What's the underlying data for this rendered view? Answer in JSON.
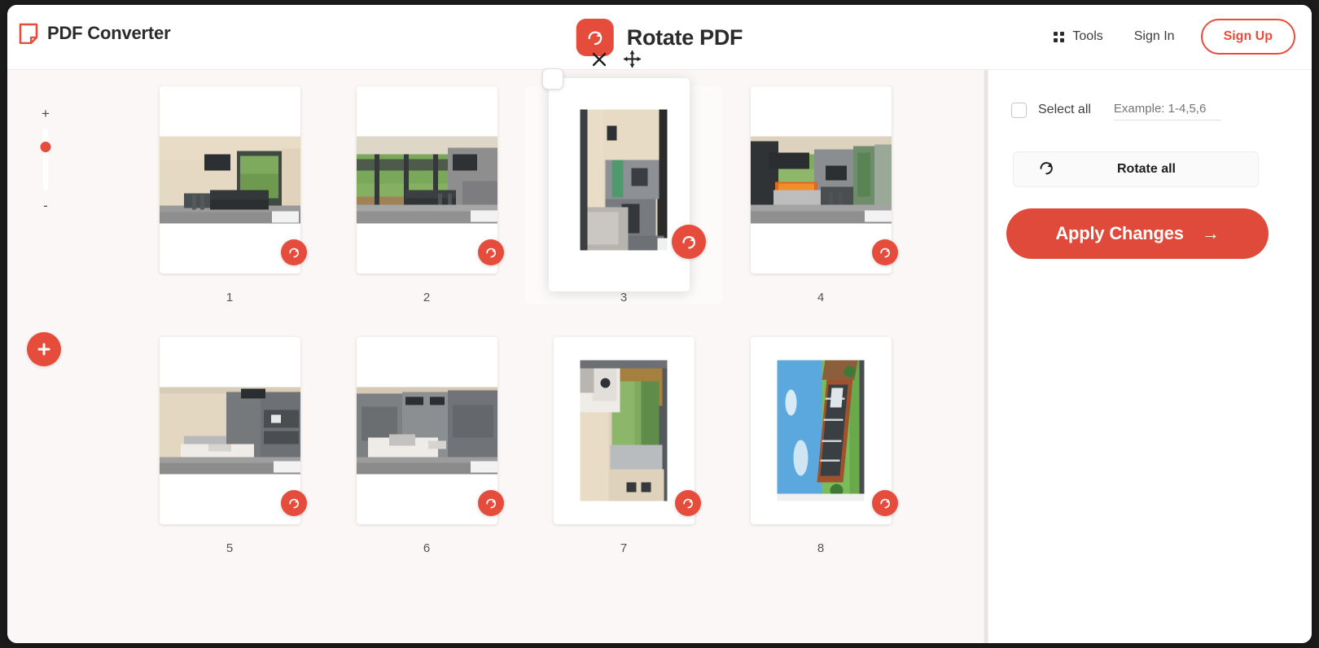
{
  "header": {
    "brand_name": "PDF Converter",
    "brand_logo_icon": "pdf-page-icon",
    "tool_name": "Rotate PDF",
    "tool_badge_icon": "rotate-clockwise-icon",
    "nav": {
      "tools_label": "Tools",
      "tools_icon": "grid-dots-icon",
      "signin_label": "Sign In",
      "signup_label": "Sign Up"
    }
  },
  "workspace": {
    "zoom": {
      "increase_label": "+",
      "decrease_label": "-"
    },
    "add_button_icon": "plus-icon",
    "active_page_tools": {
      "delete_icon": "close-x-icon",
      "move_icon": "move-arrows-icon"
    },
    "pages": [
      {
        "number": "1",
        "rotation": 0,
        "scene": "kitchen-plywood",
        "selected": false,
        "active": false
      },
      {
        "number": "2",
        "rotation": 0,
        "scene": "window-lawn",
        "selected": false,
        "active": false
      },
      {
        "number": "3",
        "rotation": 90,
        "scene": "kitchen-corridor",
        "selected": false,
        "active": true
      },
      {
        "number": "4",
        "rotation": 0,
        "scene": "fireplace-kitchen",
        "selected": false,
        "active": false
      },
      {
        "number": "5",
        "rotation": 0,
        "scene": "bedroom-cabinets",
        "selected": false,
        "active": false
      },
      {
        "number": "6",
        "rotation": 0,
        "scene": "bedroom-wardrobe",
        "selected": false,
        "active": false
      },
      {
        "number": "7",
        "rotation": 90,
        "scene": "bedroom-window",
        "selected": false,
        "active": false
      },
      {
        "number": "8",
        "rotation": 90,
        "scene": "exterior-house",
        "selected": false,
        "active": false
      }
    ],
    "rotate_button_icon": "rotate-clockwise-icon"
  },
  "panel": {
    "select_all_label": "Select all",
    "range_placeholder": "Example: 1-4,5,6",
    "range_value": "",
    "rotate_all_label": "Rotate all",
    "rotate_all_icon": "rotate-clockwise-icon",
    "apply_label": "Apply Changes",
    "apply_arrow": "→"
  },
  "colors": {
    "accent": "#e64c3c",
    "apply_button": "#df4a3b",
    "page_bg": "#fbf7f6",
    "header_bg": "#ffffff",
    "text_dark": "#2b2b2b"
  }
}
